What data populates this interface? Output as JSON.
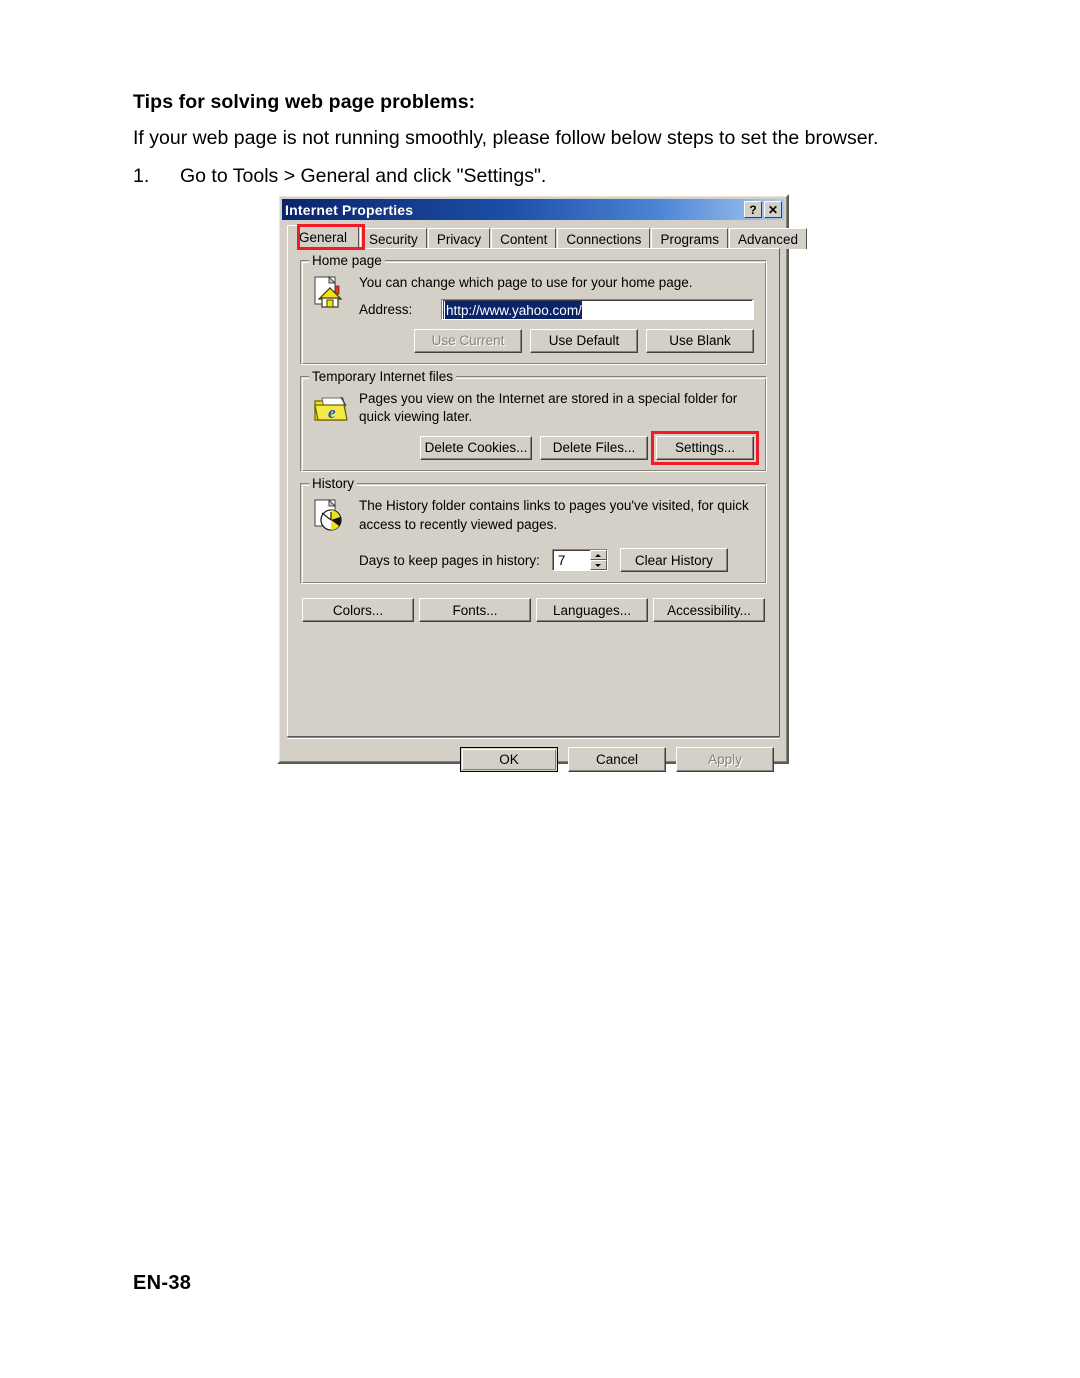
{
  "document": {
    "heading": "Tips for solving web page problems:",
    "intro": "If your web page is not running smoothly, please follow below steps to set the browser.",
    "step_number": "1.",
    "step_text": "Go to Tools > General and click \"Settings\".",
    "footer": "EN-38"
  },
  "dialog": {
    "title": "Internet Properties",
    "title_buttons": {
      "help": "?",
      "close": "✕"
    },
    "tabs": [
      {
        "label": "General",
        "active": true,
        "highlighted": true
      },
      {
        "label": "Security",
        "active": false,
        "highlighted": false
      },
      {
        "label": "Privacy",
        "active": false,
        "highlighted": false
      },
      {
        "label": "Content",
        "active": false,
        "highlighted": false
      },
      {
        "label": "Connections",
        "active": false,
        "highlighted": false
      },
      {
        "label": "Programs",
        "active": false,
        "highlighted": false
      },
      {
        "label": "Advanced",
        "active": false,
        "highlighted": false
      }
    ],
    "home_page": {
      "group_title": "Home page",
      "description": "You can change which page to use for your home page.",
      "address_label": "Address:",
      "address_value": "http://www.yahoo.com/",
      "address_selected": true,
      "buttons": [
        {
          "label": "Use Current",
          "disabled": true
        },
        {
          "label": "Use Default",
          "disabled": false
        },
        {
          "label": "Use Blank",
          "disabled": false
        }
      ]
    },
    "temp_files": {
      "group_title": "Temporary Internet files",
      "description": "Pages you view on the Internet are stored in a special folder for quick viewing later.",
      "buttons": [
        {
          "label": "Delete Cookies...",
          "disabled": false,
          "highlighted": false
        },
        {
          "label": "Delete Files...",
          "disabled": false,
          "highlighted": false
        },
        {
          "label": "Settings...",
          "disabled": false,
          "highlighted": true
        }
      ]
    },
    "history": {
      "group_title": "History",
      "description": "The History folder contains links to pages you've visited, for quick access to recently viewed pages.",
      "days_label": "Days to keep pages in history:",
      "days_value": "7",
      "clear_button": "Clear History"
    },
    "option_buttons": [
      {
        "label": "Colors..."
      },
      {
        "label": "Fonts..."
      },
      {
        "label": "Languages..."
      },
      {
        "label": "Accessibility..."
      }
    ],
    "footer_buttons": [
      {
        "label": "OK",
        "disabled": false,
        "default": true
      },
      {
        "label": "Cancel",
        "disabled": false,
        "default": false
      },
      {
        "label": "Apply",
        "disabled": true,
        "default": false
      }
    ]
  },
  "colors": {
    "dialog_face": "#d4d0c8",
    "title_gradient_start": "#0a246a",
    "title_gradient_end": "#a6caf0",
    "highlight_red": "#ee1c25",
    "selection_blue": "#0a246a"
  }
}
